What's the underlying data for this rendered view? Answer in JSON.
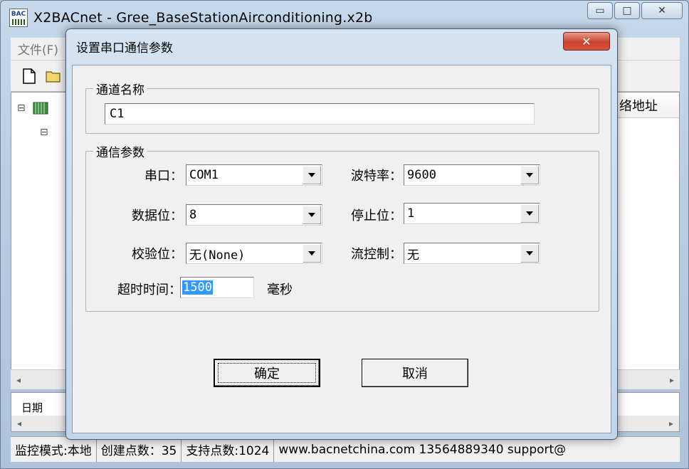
{
  "main_window": {
    "app_icon_text": "BAC",
    "title": "X2BACnet - Gree_BaseStationAirconditioning.x2b",
    "controls": {
      "minimize": "▭",
      "maximize": "□",
      "close": "✕"
    },
    "menu_first": "文件(F)",
    "tree": {
      "expander": "⊟",
      "child_expander": "⊟"
    },
    "list_header": "络地址",
    "log_label": "日期",
    "status": {
      "mode": "监控模式:本地",
      "created": "创建点数：35",
      "supported": "支持点数:1024",
      "contact": "www.bacnetchina.com 13564889340 support@"
    }
  },
  "dialog": {
    "title": "设置串口通信参数",
    "close_glyph": "✕",
    "channel_group": {
      "legend": "通道名称",
      "name_value": "C1"
    },
    "comm_group": {
      "legend": "通信参数",
      "port_label": "串口：",
      "port_value": "COM1",
      "baud_label": "波特率：",
      "baud_value": "9600",
      "databits_label": "数据位：",
      "databits_value": "8",
      "stopbits_label": "停止位：",
      "stopbits_value": "1",
      "parity_label": "校验位：",
      "parity_value": "无(None)",
      "flow_label": "流控制：",
      "flow_value": "无",
      "timeout_label": "超时时间：",
      "timeout_value": "1500",
      "timeout_unit": "毫秒"
    },
    "ok_label": "确定",
    "cancel_label": "取消"
  },
  "icons": [
    "new-file-icon",
    "open-folder-icon",
    "dropdown-arrow-icon",
    "close-icon"
  ]
}
